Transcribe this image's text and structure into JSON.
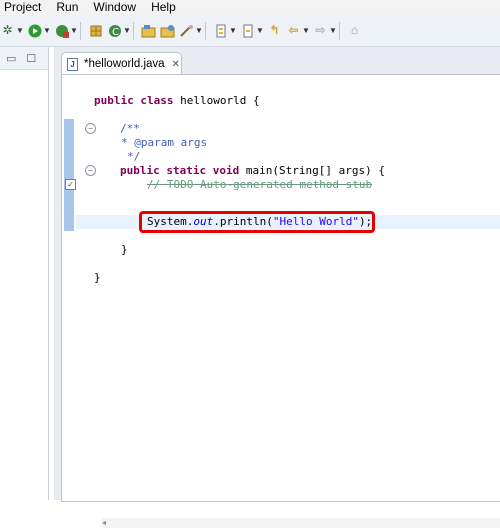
{
  "menubar": {
    "items": [
      "Project",
      "Run",
      "Window",
      "Help"
    ]
  },
  "toolbar": {
    "icons": [
      "debug-icon",
      "run-icon",
      "external-tools-icon",
      "new-java-package-icon",
      "new-java-class-icon",
      "open-type-icon",
      "open-task-icon",
      "search-icon",
      "next-annotation-icon",
      "previous-annotation-icon",
      "back-icon",
      "forward-icon",
      "pin-editor-icon"
    ]
  },
  "editor": {
    "tab_label": "*helloworld.java",
    "code_lines": [
      "public class helloworld {",
      "/**",
      " * @param args",
      " */",
      "public static void main(String[] args) {",
      "// TODO Auto-generated method stub",
      "System.out.println(\"Hello World\");",
      "}",
      "}"
    ],
    "tokens": {
      "public": "public",
      "class": "class",
      "static": "static",
      "void": "void",
      "class_name": "helloworld {",
      "doc_open": "/**",
      "doc_param_tag": "* @param",
      "doc_param_name": " args",
      "doc_close": "*/",
      "method_sig": " main(String[] args) {",
      "todo_comment": "// TODO Auto-generated method stub",
      "system": "System.",
      "out": "out",
      "println": ".println(",
      "string_literal": "\"Hello World\"",
      "stmt_end": ");",
      "brace_close": "}"
    }
  },
  "colors": {
    "keyword": "#7f0055",
    "string": "#2a00ff",
    "comment": "#3f7f5f",
    "javadoc": "#3f5fbf",
    "highlight_box": "#e60000"
  }
}
